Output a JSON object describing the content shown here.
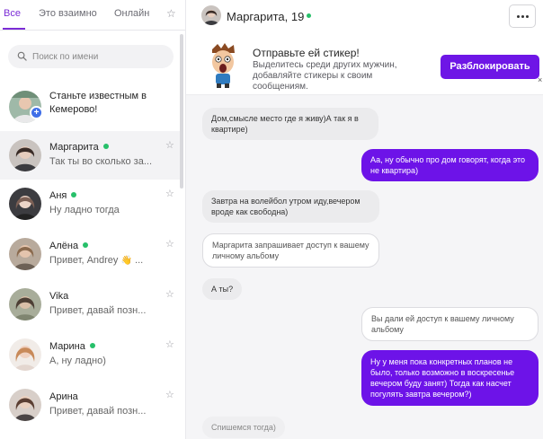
{
  "tabs": {
    "all": "Все",
    "mutual": "Это взаимно",
    "online": "Онлайн"
  },
  "search": {
    "placeholder": "Поиск по имени"
  },
  "promo": {
    "text": "Станьте известным в Кемерово!",
    "badge": "+"
  },
  "contacts": [
    {
      "name": "Маргарита",
      "message": "Так ты во сколько за...",
      "online": true
    },
    {
      "name": "Аня",
      "message": "Ну ладно тогда",
      "online": true
    },
    {
      "name": "Алёна",
      "message": "Привет, Andrey",
      "emoji": "👋",
      "ellipsis": " ...",
      "online": true
    },
    {
      "name": "Vika",
      "message": "Привет, давай позн...",
      "online": false
    },
    {
      "name": "Марина",
      "message": "А, ну ладно)",
      "online": true
    },
    {
      "name": "Арина",
      "message": "Привет, давай позн...",
      "online": false
    }
  ],
  "header": {
    "name": "Маргарита, 19"
  },
  "banner": {
    "title": "Отправьте ей стикер!",
    "text": "Выделитесь среди других мужчин, добавляйте стикеры к своим сообщениям.",
    "button": "Разблокировать"
  },
  "messages": [
    {
      "text": "Дом,смысле место где я живу)А так я в квартире)"
    },
    {
      "text": "Аа, ну обычно про дом говорят, когда это не квартира)"
    },
    {
      "text": "Завтра на волейбол утром иду,вечером вроде как свободна)"
    },
    {
      "text": "Маргарита запрашивает доступ к вашему личному альбому"
    },
    {
      "text": "А ты?"
    },
    {
      "text": "Вы дали ей доступ к вашему личному альбому"
    },
    {
      "text": "Ну у меня пока конкретных планов не было, только возможно в воскресенье вечером буду занят) Тогда как насчет погулять завтра вечером?)"
    },
    {
      "text": "Спишемся тогда)"
    }
  ],
  "colors": {
    "accent": "#6e16e6",
    "online": "#27c06a"
  },
  "icons": {
    "star": "☆",
    "close": "×"
  }
}
